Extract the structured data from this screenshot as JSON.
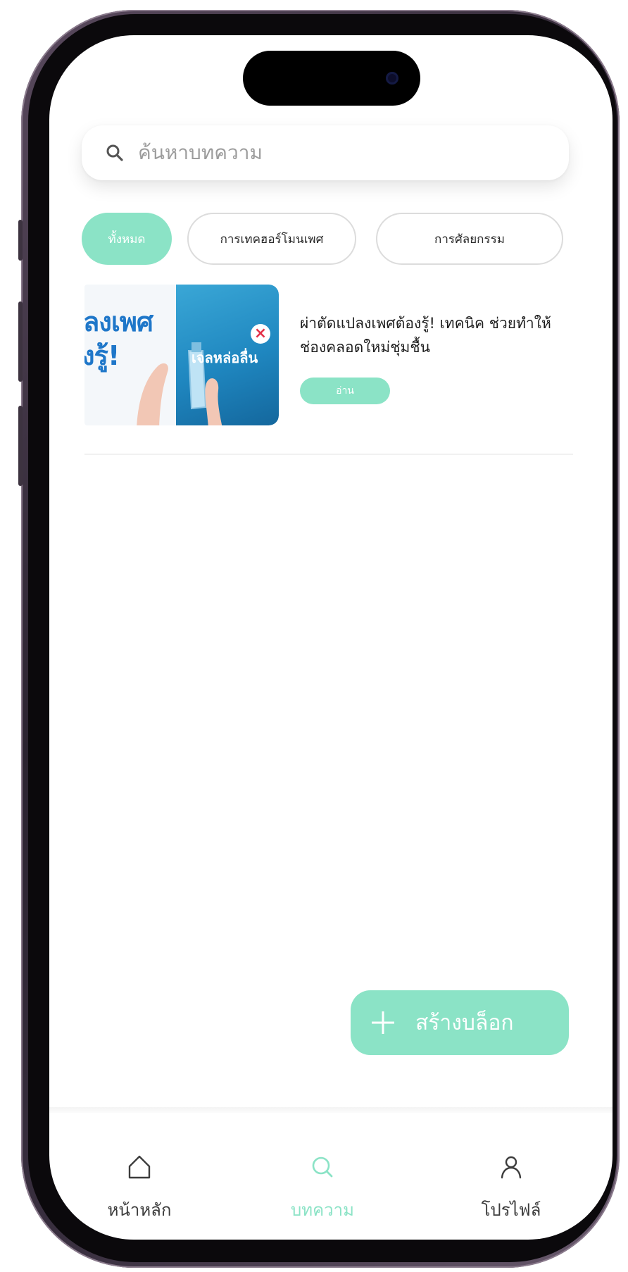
{
  "search": {
    "placeholder": "ค้นหาบทความ",
    "icon": "search-icon"
  },
  "categories": [
    {
      "label": "ทั้งหมด",
      "selected": true
    },
    {
      "label": "การเทคฮอร์โมนเพศ",
      "selected": false
    },
    {
      "label": "การศัลยกรรม",
      "selected": false
    }
  ],
  "articles": [
    {
      "thumbnail_text_line1": "ลงเพศ",
      "thumbnail_text_line2": "งรู้!",
      "thumbnail_text_line3": "เจลหล่อลื่น",
      "title": "ผ่าตัดแปลงเพศต้องรู้! เทคนิค ช่วยทำให้ช่องคลอดใหม่ชุ่มชื้น",
      "read_label": "อ่าน"
    }
  ],
  "fab": {
    "label": "สร้างบล็อก",
    "icon": "plus-icon"
  },
  "nav": {
    "items": [
      {
        "label": "หน้าหลัก",
        "icon": "home-icon",
        "active": false
      },
      {
        "label": "บทความ",
        "icon": "search-icon",
        "active": true
      },
      {
        "label": "โปรไฟล์",
        "icon": "profile-icon",
        "active": false
      }
    ]
  },
  "colors": {
    "accent": "#8be3c6",
    "frame": "#2b2330"
  }
}
